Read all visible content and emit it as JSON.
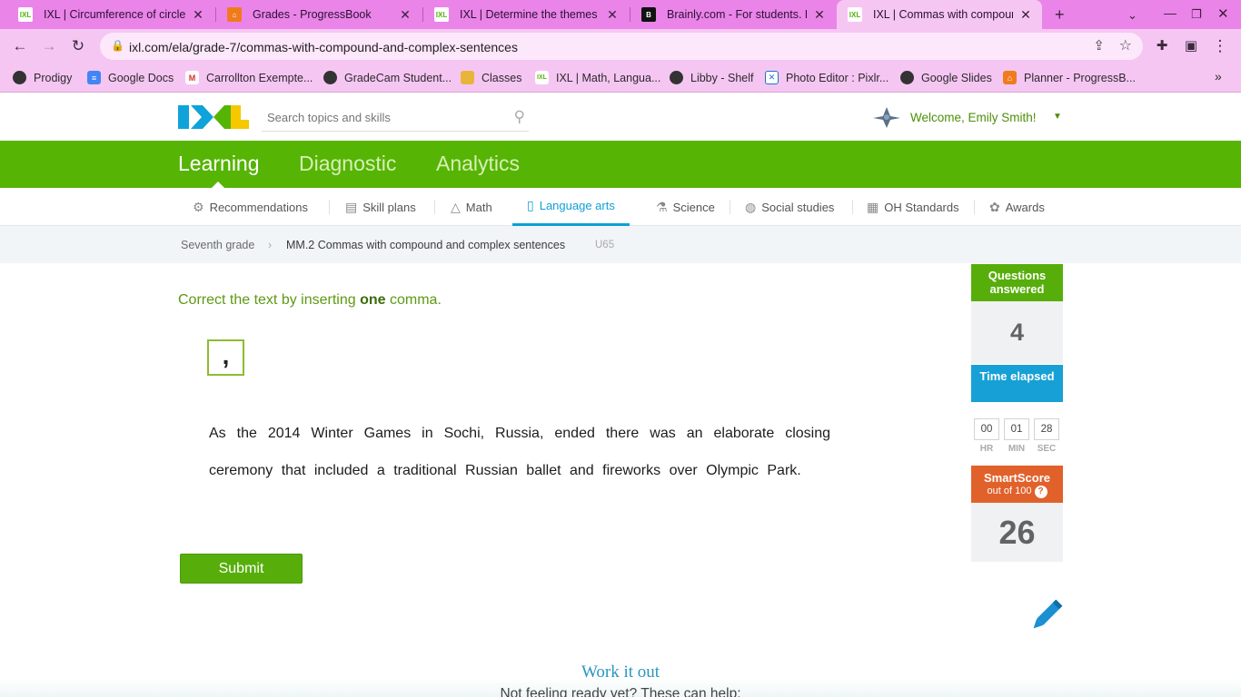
{
  "browser": {
    "tabs": [
      {
        "title": "IXL | Circumference of circles |",
        "favicon": "ixl-favicon"
      },
      {
        "title": "Grades - ProgressBook",
        "favicon": "progressbook-favicon"
      },
      {
        "title": "IXL | Determine the themes of",
        "favicon": "ixl-favicon"
      },
      {
        "title": "Brainly.com - For students. By",
        "favicon": "brainly-favicon"
      },
      {
        "title": "IXL | Commas with compound",
        "favicon": "ixl-favicon",
        "active": true
      }
    ],
    "url": "ixl.com/ela/grade-7/commas-with-compound-and-complex-sentences",
    "bookmarks": [
      {
        "label": "Prodigy"
      },
      {
        "label": "Google Docs"
      },
      {
        "label": "Carrollton Exempte..."
      },
      {
        "label": "GradeCam Student..."
      },
      {
        "label": "Classes"
      },
      {
        "label": "IXL | Math, Langua..."
      },
      {
        "label": "Libby - Shelf"
      },
      {
        "label": "Photo Editor : Pixlr..."
      },
      {
        "label": "Google Slides"
      },
      {
        "label": "Planner - ProgressB..."
      }
    ],
    "theme_color": "#ea84e8"
  },
  "header": {
    "search_placeholder": "Search topics and skills",
    "welcome": "Welcome, Emily Smith!"
  },
  "main_nav": {
    "items": [
      "Learning",
      "Diagnostic",
      "Analytics"
    ],
    "active": "Learning",
    "color": "#56b404"
  },
  "subject_nav": {
    "items": [
      "Recommendations",
      "Skill plans",
      "Math",
      "Language arts",
      "Science",
      "Social studies",
      "OH Standards",
      "Awards"
    ],
    "active": "Language arts",
    "active_color": "#0f9fd6"
  },
  "breadcrumb": {
    "grade": "Seventh grade",
    "skill": "MM.2 Commas with compound and complex sentences",
    "code": "U65"
  },
  "question": {
    "prompt_pre": "Correct the text by inserting ",
    "prompt_bold": "one",
    "prompt_post": " comma.",
    "comma_tile": ",",
    "sentence": "As the 2014 Winter Games in Sochi, Russia, ended there was an elaborate closing ceremony that included a traditional Russian ballet and fireworks over Olympic Park.",
    "submit_label": "Submit"
  },
  "stats": {
    "questions_answered_label": "Questions answered",
    "questions_answered": "4",
    "time_label": "Time elapsed",
    "time": {
      "hr": "00",
      "min": "01",
      "sec": "28"
    },
    "time_units": {
      "hr": "HR",
      "min": "MIN",
      "sec": "SEC"
    },
    "smartscore_label": "SmartScore",
    "smartscore_sub": "out of 100",
    "smartscore": "26"
  },
  "footer": {
    "work_it_out": "Work it out",
    "not_ready": "Not feeling ready yet? These can help:"
  }
}
